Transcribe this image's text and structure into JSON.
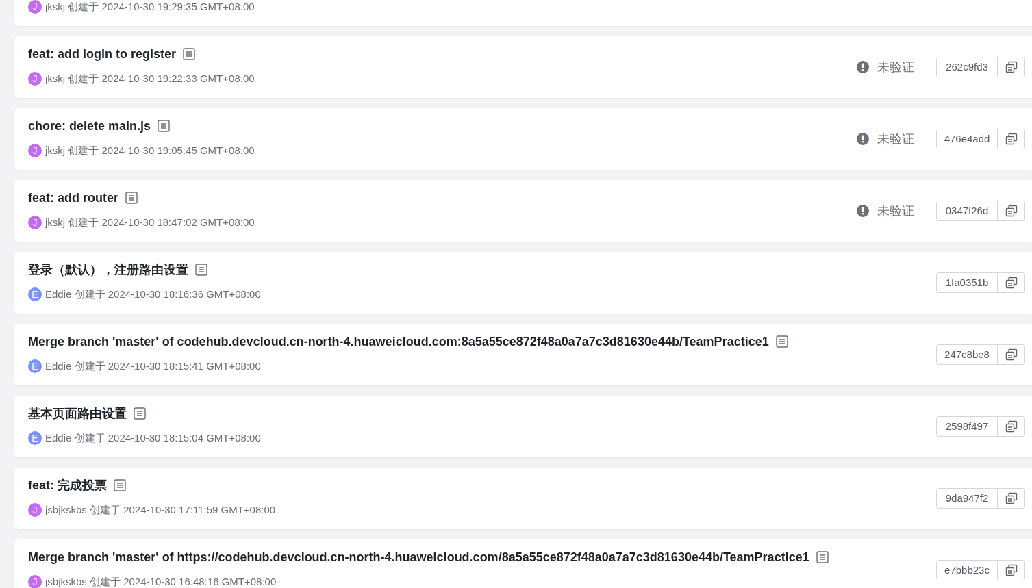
{
  "commits": [
    {
      "author": {
        "letter": "J",
        "color": "#c36cf2",
        "name": "jkskj"
      },
      "created": "创建于 2024-10-30 19:29:35 GMT+08:00"
    },
    {
      "title": "feat: add login to register",
      "author": {
        "letter": "J",
        "color": "#c36cf2",
        "name": "jkskj"
      },
      "created": "创建于 2024-10-30 19:22:33 GMT+08:00",
      "status": "未验证",
      "hash": "262c9fd3"
    },
    {
      "title": "chore: delete main.js",
      "author": {
        "letter": "J",
        "color": "#c36cf2",
        "name": "jkskj"
      },
      "created": "创建于 2024-10-30 19:05:45 GMT+08:00",
      "status": "未验证",
      "hash": "476e4add"
    },
    {
      "title": "feat: add router",
      "author": {
        "letter": "J",
        "color": "#c36cf2",
        "name": "jkskj"
      },
      "created": "创建于 2024-10-30 18:47:02 GMT+08:00",
      "status": "未验证",
      "hash": "0347f26d"
    },
    {
      "title": "登录（默认），注册路由设置",
      "author": {
        "letter": "E",
        "color": "#7b93f2",
        "name": "Eddie"
      },
      "created": "创建于 2024-10-30 18:16:36 GMT+08:00",
      "hash": "1fa0351b"
    },
    {
      "title": "Merge branch 'master' of codehub.devcloud.cn-north-4.huaweicloud.com:8a5a55ce872f48a0a7a7c3d81630e44b/TeamPractice1",
      "author": {
        "letter": "E",
        "color": "#7b93f2",
        "name": "Eddie"
      },
      "created": "创建于 2024-10-30 18:15:41 GMT+08:00",
      "hash": "247c8be8"
    },
    {
      "title": "基本页面路由设置",
      "author": {
        "letter": "E",
        "color": "#7b93f2",
        "name": "Eddie"
      },
      "created": "创建于 2024-10-30 18:15:04 GMT+08:00",
      "hash": "2598f497"
    },
    {
      "title": "feat: 完成投票",
      "author": {
        "letter": "J",
        "color": "#c36cf2",
        "name": "jsbjkskbs"
      },
      "created": "创建于 2024-10-30 17:11:59 GMT+08:00",
      "hash": "9da947f2"
    },
    {
      "title": "Merge branch 'master' of https://codehub.devcloud.cn-north-4.huaweicloud.com/8a5a55ce872f48a0a7a7c3d81630e44b/TeamPractice1",
      "author": {
        "letter": "J",
        "color": "#c36cf2",
        "name": "jsbjkskbs"
      },
      "created": "创建于 2024-10-30 16:48:16 GMT+08:00",
      "hash": "e7bbb23c"
    }
  ]
}
